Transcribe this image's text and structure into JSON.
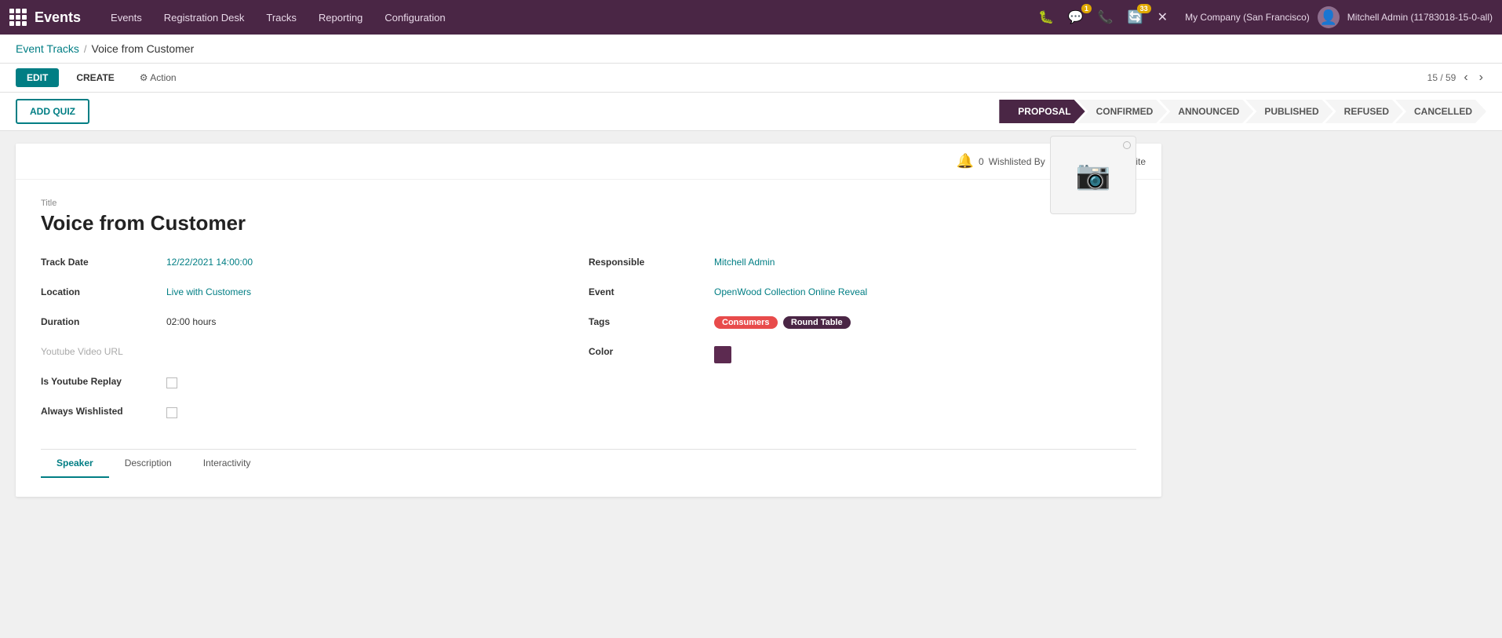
{
  "app": {
    "grid_icon": "grid-icon",
    "brand": "Events"
  },
  "topnav": {
    "links": [
      "Events",
      "Registration Desk",
      "Tracks",
      "Reporting",
      "Configuration"
    ],
    "icons": [
      {
        "name": "bug-icon",
        "symbol": "🐛",
        "badge": null
      },
      {
        "name": "chat-icon",
        "symbol": "💬",
        "badge": "1"
      },
      {
        "name": "phone-icon",
        "symbol": "📞",
        "badge": null
      },
      {
        "name": "refresh-icon",
        "symbol": "🔄",
        "badge": "33"
      },
      {
        "name": "close-icon",
        "symbol": "✕",
        "badge": null
      }
    ],
    "company": "My Company (San Francisco)",
    "user": "Mitchell Admin (11783018-15-0-all)"
  },
  "breadcrumb": {
    "parent": "Event Tracks",
    "current": "Voice from Customer"
  },
  "toolbar": {
    "edit_label": "EDIT",
    "create_label": "CREATE",
    "action_label": "⚙ Action",
    "pagination": "15 / 59"
  },
  "status_bar": {
    "add_quiz_label": "ADD QUIZ",
    "stages": [
      {
        "key": "proposal",
        "label": "PROPOSAL",
        "active": true
      },
      {
        "key": "confirmed",
        "label": "CONFIRMED",
        "active": false
      },
      {
        "key": "announced",
        "label": "ANNOUNCED",
        "active": false
      },
      {
        "key": "published",
        "label": "PUBLISHED",
        "active": false
      },
      {
        "key": "refused",
        "label": "REFUSED",
        "active": false
      },
      {
        "key": "cancelled",
        "label": "CANCELLED",
        "active": false
      }
    ]
  },
  "card": {
    "wishlisted_label": "0",
    "wishlisted_suffix": "Wishlisted By",
    "go_to_website_label": "Go to Website",
    "title_label": "Title",
    "title": "Voice from Customer",
    "fields_left": [
      {
        "label": "Track Date",
        "value": "12/22/2021 14:00:00",
        "type": "link"
      },
      {
        "label": "Location",
        "value": "Live with Customers",
        "type": "link"
      },
      {
        "label": "Duration",
        "value": "02:00 hours",
        "type": "text"
      },
      {
        "label": "Youtube Video URL",
        "value": "",
        "type": "muted-label"
      },
      {
        "label": "Is Youtube Replay",
        "value": "",
        "type": "checkbox"
      },
      {
        "label": "Always Wishlisted",
        "value": "",
        "type": "checkbox"
      }
    ],
    "fields_right": [
      {
        "label": "Responsible",
        "value": "Mitchell Admin",
        "type": "link"
      },
      {
        "label": "Event",
        "value": "OpenWood Collection Online Reveal",
        "type": "link"
      },
      {
        "label": "Tags",
        "value": "",
        "type": "tags"
      },
      {
        "label": "Color",
        "value": "",
        "type": "color"
      }
    ],
    "tags": [
      {
        "label": "Consumers",
        "class": "consumers"
      },
      {
        "label": "Round Table",
        "class": "roundtable"
      }
    ],
    "color_value": "#5c2a50",
    "tabs": [
      {
        "label": "Speaker",
        "active": true
      },
      {
        "label": "Description",
        "active": false
      },
      {
        "label": "Interactivity",
        "active": false
      }
    ]
  }
}
